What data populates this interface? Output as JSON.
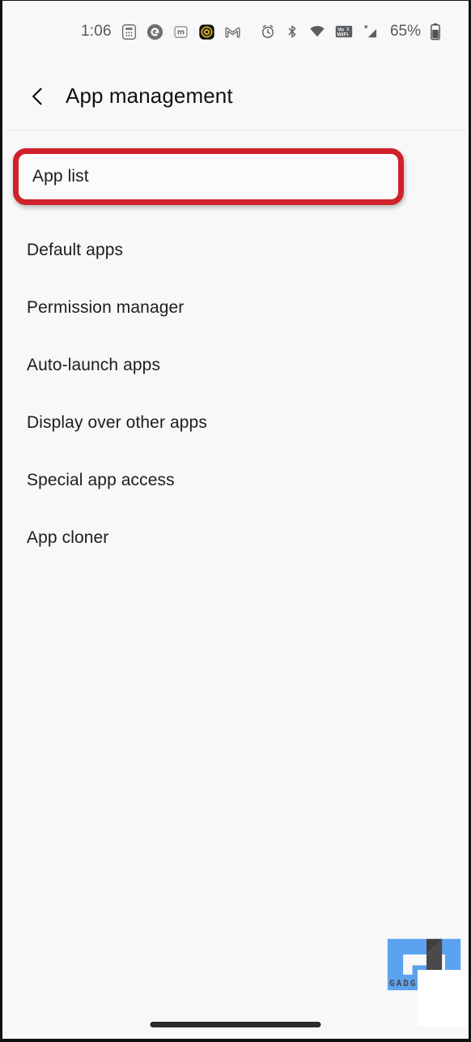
{
  "status_bar": {
    "time": "1:06",
    "battery_percent": "65%",
    "left_icons": [
      {
        "name": "dialpad-icon",
        "label": "Dialpad"
      },
      {
        "name": "google-icon",
        "label": "G"
      },
      {
        "name": "mastodon-icon",
        "label": "m"
      },
      {
        "name": "gold-app-icon",
        "label": "App"
      },
      {
        "name": "gmail-icon",
        "label": "M"
      }
    ],
    "right_icons": [
      {
        "name": "alarm-icon",
        "label": "Alarm"
      },
      {
        "name": "bluetooth-icon",
        "label": "Bluetooth"
      },
      {
        "name": "wifi-icon",
        "label": "Wi-Fi"
      },
      {
        "name": "vowifi-icon",
        "label": "VoWiFi"
      },
      {
        "name": "cellular-signal-icon",
        "label": "X"
      },
      {
        "name": "battery-icon",
        "label": "Battery"
      }
    ]
  },
  "header": {
    "back_label": "Back",
    "title": "App management"
  },
  "list": {
    "highlighted_item": {
      "label": "App list",
      "highlight_color": "#d0212b"
    },
    "items": [
      {
        "label": "Default apps"
      },
      {
        "label": "Permission manager"
      },
      {
        "label": "Auto-launch apps"
      },
      {
        "label": "Display over other apps"
      },
      {
        "label": "Special app access"
      },
      {
        "label": "App cloner"
      }
    ]
  },
  "watermark": {
    "text": "GADG",
    "blue": "#5ba3f0",
    "dark": "#4a4a4a"
  },
  "navigation": {
    "home_indicator_label": "Home"
  }
}
